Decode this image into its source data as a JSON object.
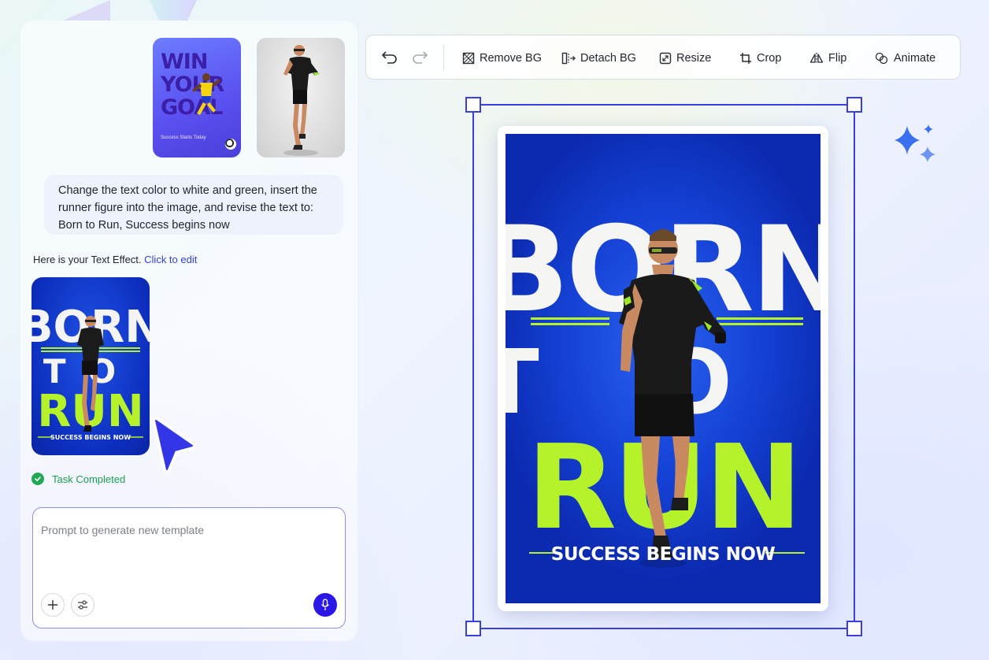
{
  "chat": {
    "thumbnails": {
      "goal_lines": [
        "WIN",
        "YOUR",
        "GOAL"
      ],
      "goal_tagline": "Success Starts Today"
    },
    "user_message": "Change the text color to white and green, insert the runner figure into the image, and revise the text to: Born to Run, Success begins now",
    "result_intro": "Here is your Text Effect.",
    "result_link": "Click to edit",
    "result_thumb": {
      "line1": "BORN",
      "line2": "TO",
      "line3": "RUN",
      "tagline": "SUCCESS BEGINS NOW"
    },
    "status": "Task Completed"
  },
  "prompt": {
    "placeholder": "Prompt to generate new template"
  },
  "toolbar": {
    "tools": [
      {
        "label": "Remove BG",
        "icon": "remove-bg-icon"
      },
      {
        "label": "Detach BG",
        "icon": "detach-bg-icon"
      },
      {
        "label": "Resize",
        "icon": "resize-icon"
      },
      {
        "label": "Crop",
        "icon": "crop-icon"
      },
      {
        "label": "Flip",
        "icon": "flip-icon"
      },
      {
        "label": "Animate",
        "icon": "animate-icon"
      }
    ]
  },
  "poster": {
    "line1": "BORN",
    "line2": "TO",
    "line3": "RUN",
    "tagline": "SUCCESS BEGINS NOW"
  },
  "colors": {
    "accent": "#2b17e8",
    "selection": "#3a3fe0",
    "poster_blue": "#1542d6",
    "poster_green": "#b6f22a",
    "status_green": "#22a854"
  }
}
